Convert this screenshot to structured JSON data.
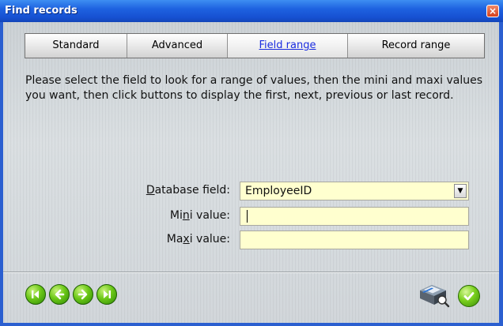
{
  "window": {
    "title": "Find records",
    "close_label": "×"
  },
  "tabs": [
    {
      "label": "Standard",
      "active": false
    },
    {
      "label": "Advanced",
      "active": false
    },
    {
      "label": "Field range",
      "active": true
    },
    {
      "label": "Record range",
      "active": false
    }
  ],
  "instructions": "Please select the field to look for a range of values, then the mini and maxi values you want, then click buttons to display the first, next, previous or last record.",
  "fields": {
    "database_field": {
      "label_pre": "",
      "label_acc": "D",
      "label_post": "atabase field:",
      "value": "EmployeeID"
    },
    "mini_value": {
      "label_pre": "Mi",
      "label_acc": "n",
      "label_post": "i value:",
      "value": ""
    },
    "maxi_value": {
      "label_pre": "Ma",
      "label_acc": "x",
      "label_post": "i value:",
      "value": ""
    }
  },
  "navigation": [
    {
      "name": "first-record-button",
      "icon": "skip-first-icon"
    },
    {
      "name": "previous-record-button",
      "icon": "arrow-left-icon"
    },
    {
      "name": "next-record-button",
      "icon": "arrow-right-icon"
    },
    {
      "name": "last-record-button",
      "icon": "skip-last-icon"
    }
  ],
  "actions": {
    "print_icon": "printer-icon",
    "ok_icon": "checkmark-icon"
  },
  "colors": {
    "title_bar": "#1e62e0",
    "active_tab_text": "#1b2de0",
    "field_background": "#ffffcf",
    "nav_button": "#6cc818"
  }
}
